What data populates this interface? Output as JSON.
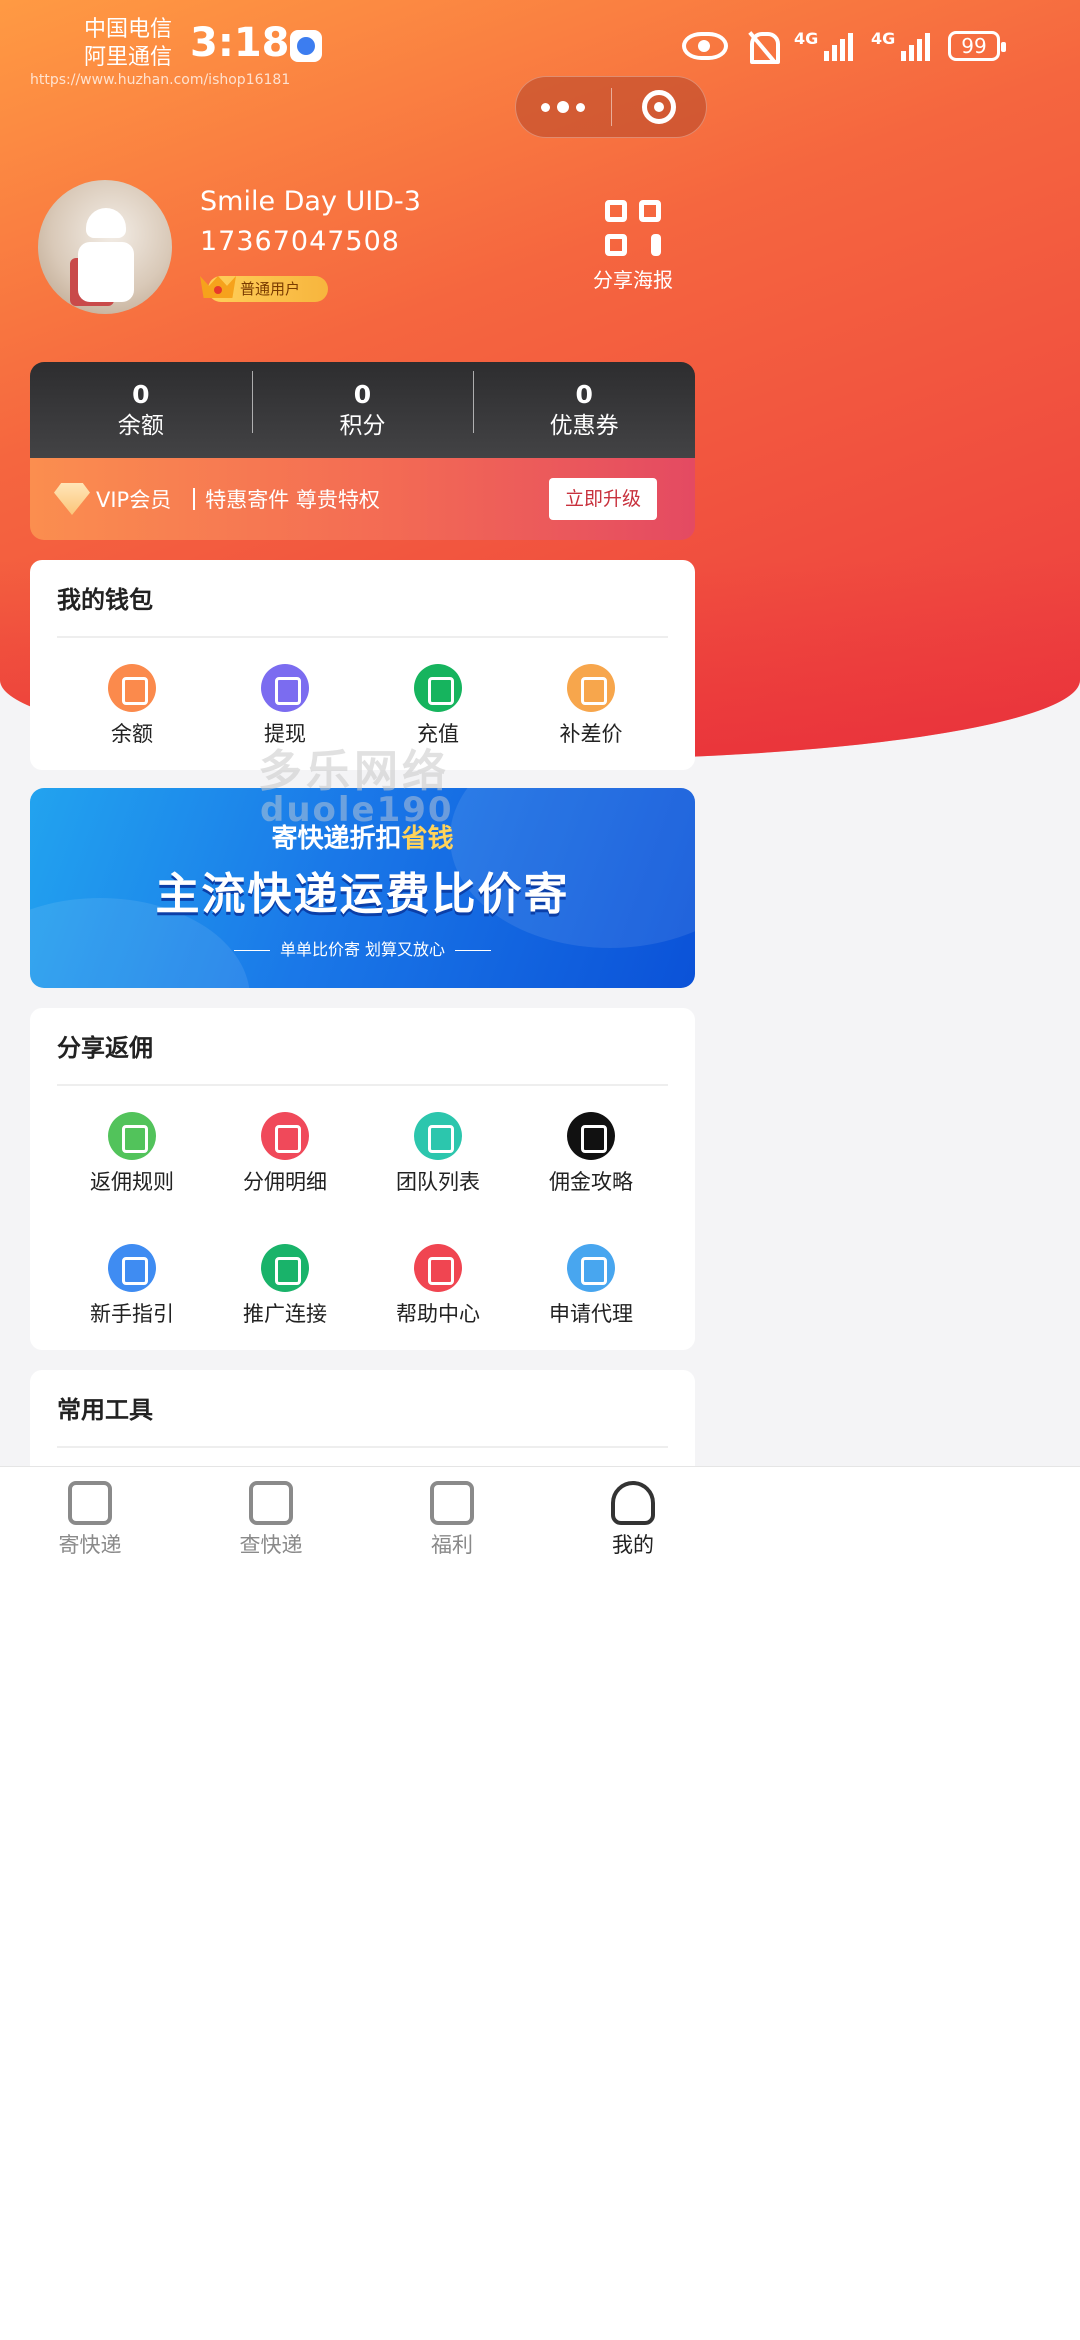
{
  "status_bar": {
    "carrier_1": "中国电信",
    "carrier_2": "阿里通信",
    "time": "3:18",
    "url_watermark": "https://www.huzhan.com/ishop16181",
    "network_1": "4G",
    "network_2": "4G",
    "battery": "99"
  },
  "profile": {
    "name": "Smile Day UID-3",
    "phone": "17367047508",
    "level": "普通用户",
    "share_poster_label": "分享海报"
  },
  "stats": [
    {
      "value": "0",
      "label": "余额"
    },
    {
      "value": "0",
      "label": "积分"
    },
    {
      "value": "0",
      "label": "优惠券"
    }
  ],
  "vip": {
    "label": "VIP会员",
    "description": "特惠寄件 尊贵特权",
    "upgrade_label": "立即升级"
  },
  "wallet": {
    "title": "我的钱包",
    "items": [
      {
        "label": "余额",
        "icon": "money-bag-icon",
        "color": "#fb8a4c"
      },
      {
        "label": "提现",
        "icon": "house-yen-icon",
        "color": "#7b6cf0"
      },
      {
        "label": "充值",
        "icon": "card-recharge-icon",
        "color": "#16b45e"
      },
      {
        "label": "补差价",
        "icon": "briefcase-icon",
        "color": "#f7a64c"
      }
    ]
  },
  "watermark": {
    "line1": "多乐网络",
    "line2": "duole190"
  },
  "banner": {
    "subtitle_prefix": "寄快递折扣",
    "subtitle_highlight": "省钱",
    "title": "主流快递运费比价寄",
    "tagline": "单单比价寄 划算又放心"
  },
  "rebate": {
    "title": "分享返佣",
    "items": [
      {
        "label": "返佣规则",
        "icon": "shield-check-icon",
        "color": "#52c35b"
      },
      {
        "label": "分佣明细",
        "icon": "document-icon",
        "color": "#f0495a"
      },
      {
        "label": "团队列表",
        "icon": "list-icon",
        "color": "#2cc6ad"
      },
      {
        "label": "佣金攻略",
        "icon": "team-icon",
        "color": "#111111"
      },
      {
        "label": "新手指引",
        "icon": "guide-icon",
        "color": "#3f8cf2"
      },
      {
        "label": "推广连接",
        "icon": "link-icon",
        "color": "#19b36a"
      },
      {
        "label": "帮助中心",
        "icon": "help-icon",
        "color": "#f04551"
      },
      {
        "label": "申请代理",
        "icon": "agent-card-icon",
        "color": "#48a6ef"
      }
    ]
  },
  "tools": {
    "title": "常用工具"
  },
  "tab_bar": [
    {
      "label": "寄快递",
      "icon": "send-package-icon",
      "active": false
    },
    {
      "label": "查快递",
      "icon": "track-package-icon",
      "active": false
    },
    {
      "label": "福利",
      "icon": "gift-icon",
      "active": false
    },
    {
      "label": "我的",
      "icon": "user-icon",
      "active": true
    }
  ]
}
